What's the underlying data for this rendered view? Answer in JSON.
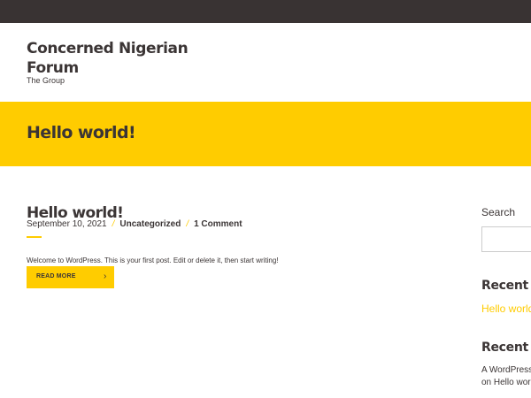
{
  "site": {
    "title": "Concerned Nigerian Forum",
    "tagline": "The Group"
  },
  "banner": {
    "title": "Hello world!"
  },
  "post": {
    "title": "Hello world!",
    "date": "September 10, 2021",
    "separator": "/",
    "category": "Uncategorized",
    "comments": "1 Comment",
    "excerpt": "Welcome to WordPress. This is your first post. Edit or delete it, then start writing!",
    "read_more_label": "READ MORE",
    "read_more_icon": "chevron-right-icon",
    "read_more_glyph": "›"
  },
  "sidebar": {
    "search_label": "Search",
    "search_placeholder": "",
    "recent_posts_title": "Recent Posts",
    "recent_posts": [
      "Hello world!"
    ],
    "recent_comments_title": "Recent Comments",
    "recent_comment_line1": "A WordPress Commenter",
    "recent_comment_line2": "on Hello world!"
  },
  "colors": {
    "topbar": "#393333",
    "accent": "#ffcc00",
    "text": "#3b3535"
  }
}
